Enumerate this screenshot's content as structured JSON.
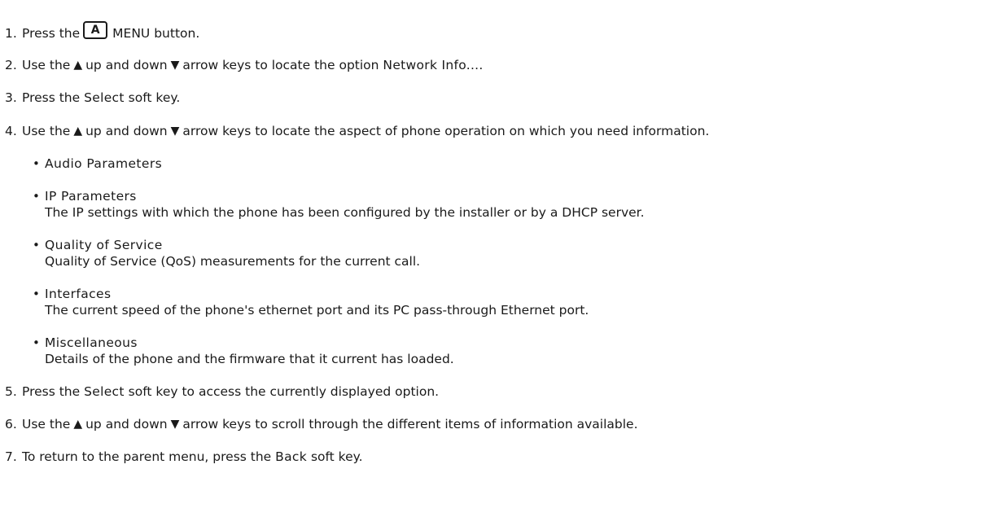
{
  "steps": [
    {
      "num": "1.",
      "pre": "Press the",
      "key_label": "A",
      "post": "MENU button."
    },
    {
      "num": "2.",
      "pre": "Use the",
      "up": "▲",
      "mid": "up and down",
      "down": "▼",
      "post1": "arrow keys to locate the option",
      "option": "Network Info...",
      "post2": "."
    },
    {
      "num": "3.",
      "pre": "Press the",
      "soft": "Select",
      "post": "soft key."
    },
    {
      "num": "4.",
      "pre": "Use the",
      "up": "▲",
      "mid": "up and down",
      "down": "▼",
      "post": "arrow keys to locate the aspect of phone operation on which you need information."
    },
    {
      "num": "5.",
      "pre": "Press the",
      "soft": "Select",
      "post": "soft key to access the currently displayed option."
    },
    {
      "num": "6.",
      "pre": "Use the",
      "up": "▲",
      "mid": "up and down",
      "down": "▼",
      "post": "arrow keys to scroll through the different items of information available."
    },
    {
      "num": "7.",
      "pre": "To return to the parent menu, press the",
      "soft": "Back",
      "post": "soft key."
    }
  ],
  "options": [
    {
      "title": "Audio Parameters",
      "desc": ""
    },
    {
      "title": "IP Parameters",
      "desc": "The IP settings with which the phone has been configured by the installer or by a DHCP server."
    },
    {
      "title": "Quality of Service",
      "desc": "Quality of Service (QoS) measurements for the current call."
    },
    {
      "title": "Interfaces",
      "desc": "The current speed of the phone's ethernet port and its PC pass-through Ethernet port."
    },
    {
      "title": "Miscellaneous",
      "desc": "Details of the phone and the firmware that it current has loaded."
    }
  ],
  "bullet_glyph": "•"
}
